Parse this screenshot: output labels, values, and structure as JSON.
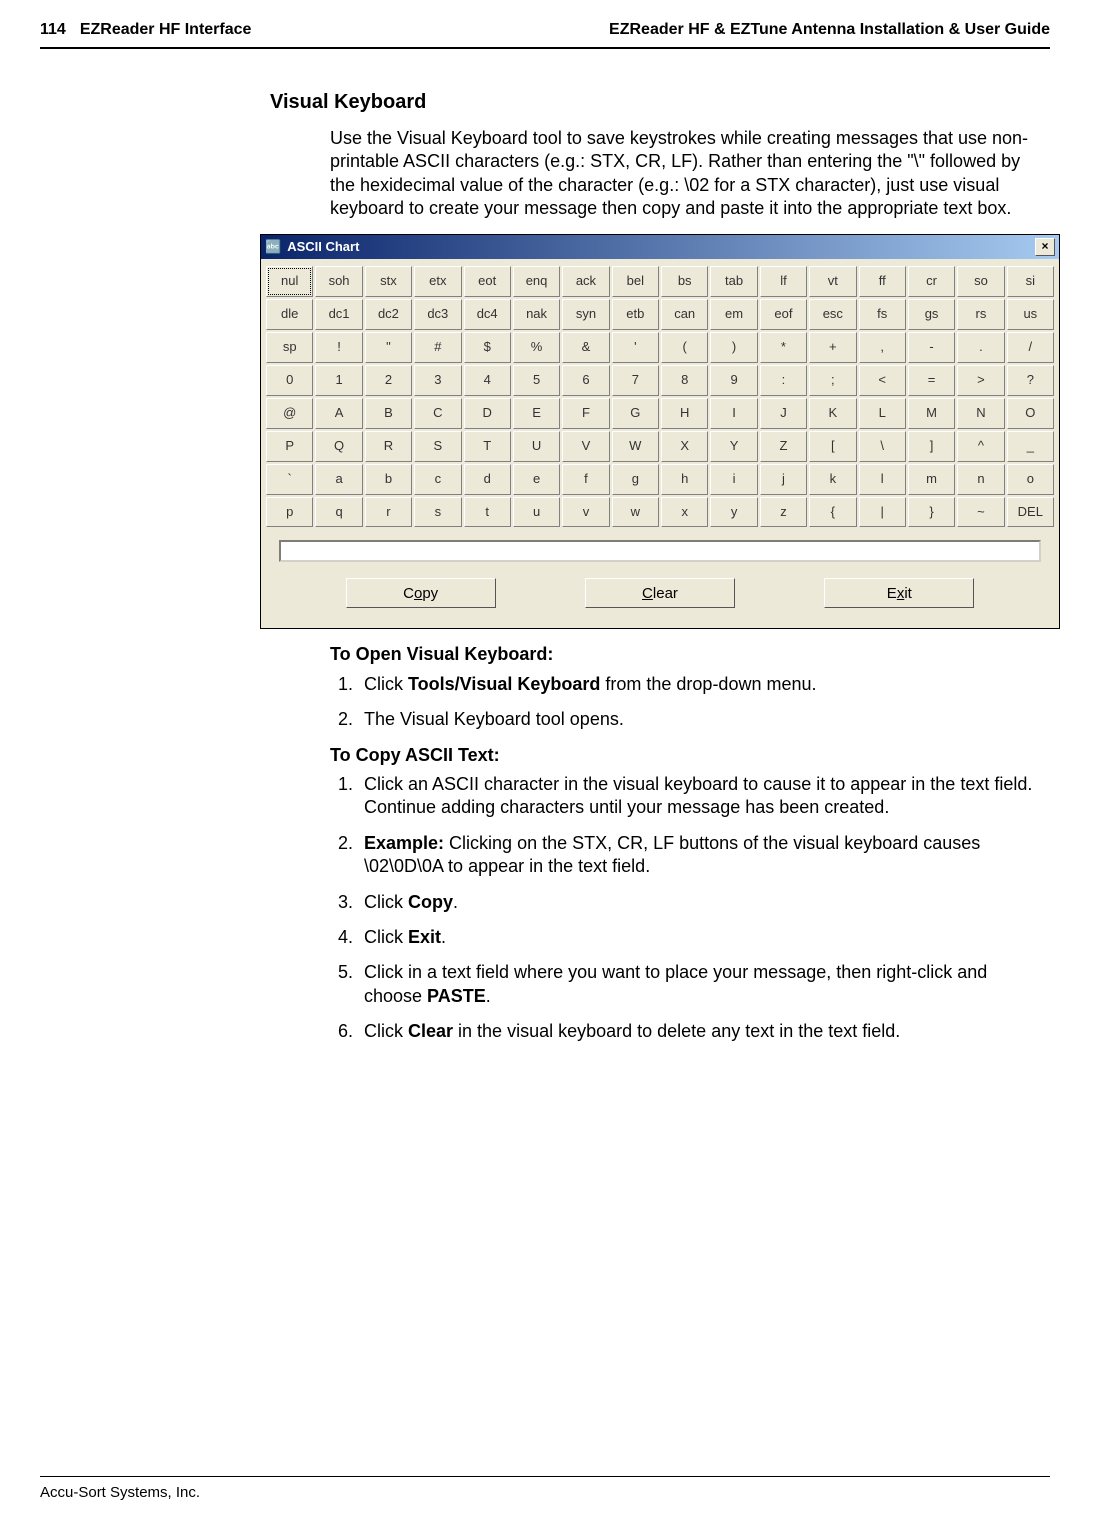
{
  "header": {
    "page_num": "114",
    "section": "EZReader HF Interface",
    "doc_title": "EZReader HF & EZTune Antenna Installation & User Guide"
  },
  "section_title": "Visual Keyboard",
  "intro": "Use the Visual Keyboard tool to save keystrokes while creating messages that use non-printable ASCII characters (e.g.: STX, CR, LF). Rather than entering the \"\\\" followed by the hexidecimal value of the character (e.g.: \\02 for a STX character), just use visual keyboard to create your message then copy and paste it into the appropriate text box.",
  "window": {
    "title": "ASCII Chart",
    "close_label": "×",
    "rows": [
      [
        "nul",
        "soh",
        "stx",
        "etx",
        "eot",
        "enq",
        "ack",
        "bel",
        "bs",
        "tab",
        "lf",
        "vt",
        "ff",
        "cr",
        "so",
        "si"
      ],
      [
        "dle",
        "dc1",
        "dc2",
        "dc3",
        "dc4",
        "nak",
        "syn",
        "etb",
        "can",
        "em",
        "eof",
        "esc",
        "fs",
        "gs",
        "rs",
        "us"
      ],
      [
        "sp",
        "!",
        "\"",
        "#",
        "$",
        "%",
        "&",
        "'",
        "(",
        ")",
        "*",
        "+",
        ",",
        "-",
        ".",
        "/"
      ],
      [
        "0",
        "1",
        "2",
        "3",
        "4",
        "5",
        "6",
        "7",
        "8",
        "9",
        ":",
        ";",
        "<",
        "=",
        ">",
        "?"
      ],
      [
        "@",
        "A",
        "B",
        "C",
        "D",
        "E",
        "F",
        "G",
        "H",
        "I",
        "J",
        "K",
        "L",
        "M",
        "N",
        "O"
      ],
      [
        "P",
        "Q",
        "R",
        "S",
        "T",
        "U",
        "V",
        "W",
        "X",
        "Y",
        "Z",
        "[",
        "\\",
        "]",
        "^",
        "_"
      ],
      [
        "`",
        "a",
        "b",
        "c",
        "d",
        "e",
        "f",
        "g",
        "h",
        "i",
        "j",
        "k",
        "l",
        "m",
        "n",
        "o"
      ],
      [
        "p",
        "q",
        "r",
        "s",
        "t",
        "u",
        "v",
        "w",
        "x",
        "y",
        "z",
        "{",
        "|",
        "}",
        "~",
        "DEL"
      ]
    ],
    "buttons": {
      "copy_pre": "C",
      "copy_u": "o",
      "copy_post": "py",
      "clear_u": "C",
      "clear_post": "lear",
      "exit_pre": "E",
      "exit_u": "x",
      "exit_post": "it"
    }
  },
  "open_heading": "To Open Visual Keyboard:",
  "open_steps": [
    {
      "pre": "Click ",
      "bold": "Tools/Visual Keyboard",
      "post": " from the drop-down menu."
    },
    {
      "plain": "The Visual Keyboard tool opens."
    }
  ],
  "copy_heading": "To Copy ASCII Text:",
  "copy_steps": [
    {
      "plain": "Click an ASCII character in the visual keyboard to cause it to appear in the text field. Continue adding characters until your message has been created."
    },
    {
      "bold": "Example:",
      "post": " Clicking on the STX, CR, LF buttons of the visual keyboard causes \\02\\0D\\0A to appear in the text field."
    },
    {
      "pre": "Click ",
      "bold": "Copy",
      "post": "."
    },
    {
      "pre": "Click ",
      "bold": "Exit",
      "post": "."
    },
    {
      "pre": "Click in a text field where you want to place your message, then right-click and choose ",
      "bold": "PASTE",
      "post": "."
    },
    {
      "pre": "Click ",
      "bold": "Clear",
      "post": " in the visual keyboard to delete any text in the text field."
    }
  ],
  "footer": "Accu-Sort Systems, Inc."
}
